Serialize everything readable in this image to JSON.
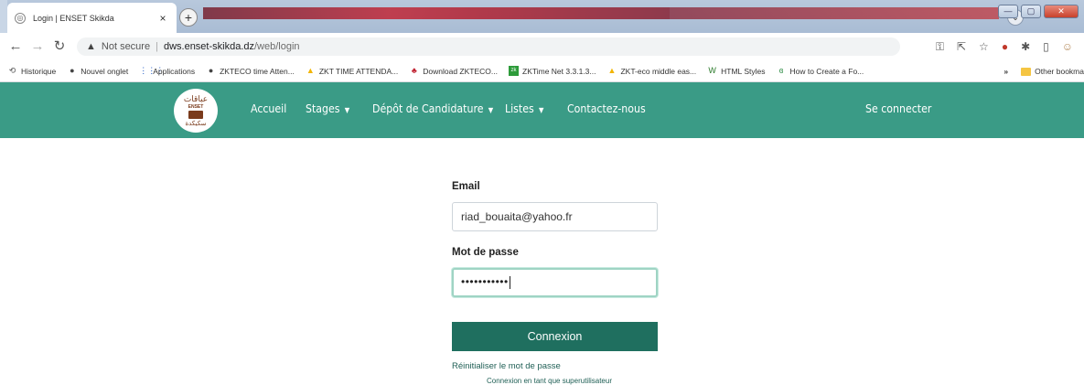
{
  "browser": {
    "tab_title": "Login | ENSET Skikda",
    "tab_close": "×",
    "new_tab": "+",
    "omnibox": {
      "warning_icon": "warning-triangle-icon",
      "not_secure": "Not secure",
      "separator": "|",
      "host": "dws.enset-skikda.dz",
      "path": "/web/login"
    },
    "bookmarks": [
      {
        "label": "Historique",
        "icon": "history-icon",
        "glyph": "⟲",
        "color": "#555555"
      },
      {
        "label": "Nouvel onglet",
        "icon": "globe-icon",
        "glyph": "●",
        "color": "#444444"
      },
      {
        "label": "Applications",
        "icon": "apps-grid-icon",
        "glyph": "⋮⋮⋮",
        "color": "#1a56c4"
      },
      {
        "label": "ZKTECO time Atten...",
        "icon": "globe-icon",
        "glyph": "●",
        "color": "#444444"
      },
      {
        "label": "ZKT TIME ATTENDA...",
        "icon": "drive-icon",
        "glyph": "▲",
        "color": "#f2b400"
      },
      {
        "label": "Download ZKTECO...",
        "icon": "bookmark-icon",
        "glyph": "♣",
        "color": "#c02030"
      },
      {
        "label": "ZKTime Net 3.3.1.3...",
        "icon": "zk-icon",
        "glyph": "zk",
        "color": "#2d9b3a"
      },
      {
        "label": "ZKT-eco middle eas...",
        "icon": "drive-icon",
        "glyph": "▲",
        "color": "#f2b400"
      },
      {
        "label": "HTML Styles",
        "icon": "w3-icon",
        "glyph": "W",
        "color": "#2a7a2a"
      },
      {
        "label": "How to Create a Fo...",
        "icon": "gfg-icon",
        "glyph": "ɞ",
        "color": "#2f8d46"
      }
    ],
    "more_bookmarks": "»",
    "other_bookmarks": "Other bookma"
  },
  "site": {
    "logo": {
      "top": "عباقات",
      "mid": "ENSET",
      "bottom": "سكيكدة"
    },
    "nav": [
      {
        "label": "Accueil",
        "dropdown": false
      },
      {
        "label": "Stages",
        "dropdown": true
      },
      {
        "label": "Dépôt de Candidature",
        "dropdown": true
      },
      {
        "label": "Listes",
        "dropdown": true
      },
      {
        "label": "Contactez-nous",
        "dropdown": false
      }
    ],
    "caret": "▼",
    "signin": "Se connecter"
  },
  "login_form": {
    "email_label": "Email",
    "email_value": "riad_bouaita@yahoo.fr",
    "password_label": "Mot de passe",
    "password_masked": "•••••••••••",
    "submit_label": "Connexion",
    "reset_link": "Réinitialiser le mot de passe",
    "superuser_link": "Connexion en tant que superutilisateur"
  },
  "colors": {
    "navbar": "#3a9b86",
    "button": "#1f6f5f"
  }
}
